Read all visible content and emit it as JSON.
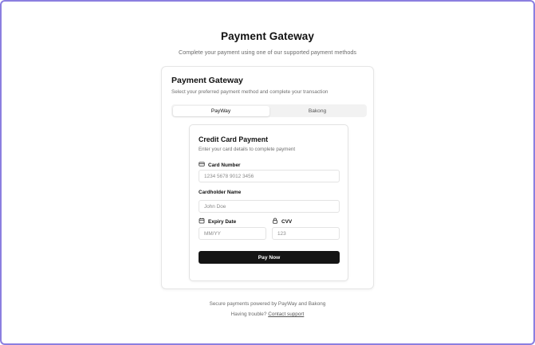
{
  "page": {
    "title": "Payment Gateway",
    "subtitle": "Complete your payment using one of our supported payment methods"
  },
  "card": {
    "title": "Payment Gateway",
    "description": "Select your preferred payment method and complete your transaction",
    "tabs": [
      {
        "label": "PayWay",
        "active": true
      },
      {
        "label": "Bakong",
        "active": false
      }
    ]
  },
  "form": {
    "title": "Credit Card Payment",
    "description": "Enter your card details to complete payment",
    "card_number": {
      "label": "Card Number",
      "placeholder": "1234 5678 9012 3456",
      "icon": "credit-card-icon"
    },
    "cardholder": {
      "label": "Cardholder Name",
      "placeholder": "John Doe"
    },
    "expiry": {
      "label": "Expiry Date",
      "placeholder": "MM/YY",
      "icon": "calendar-icon"
    },
    "cvv": {
      "label": "CVV",
      "placeholder": "123",
      "icon": "lock-icon"
    },
    "submit_label": "Pay Now"
  },
  "footer": {
    "line1": "Secure payments powered by PayWay and Bakong",
    "trouble_text": "Having trouble?",
    "contact_link": "Contact support"
  },
  "colors": {
    "accent_border": "#8b7fe0",
    "button_bg": "#141414"
  }
}
